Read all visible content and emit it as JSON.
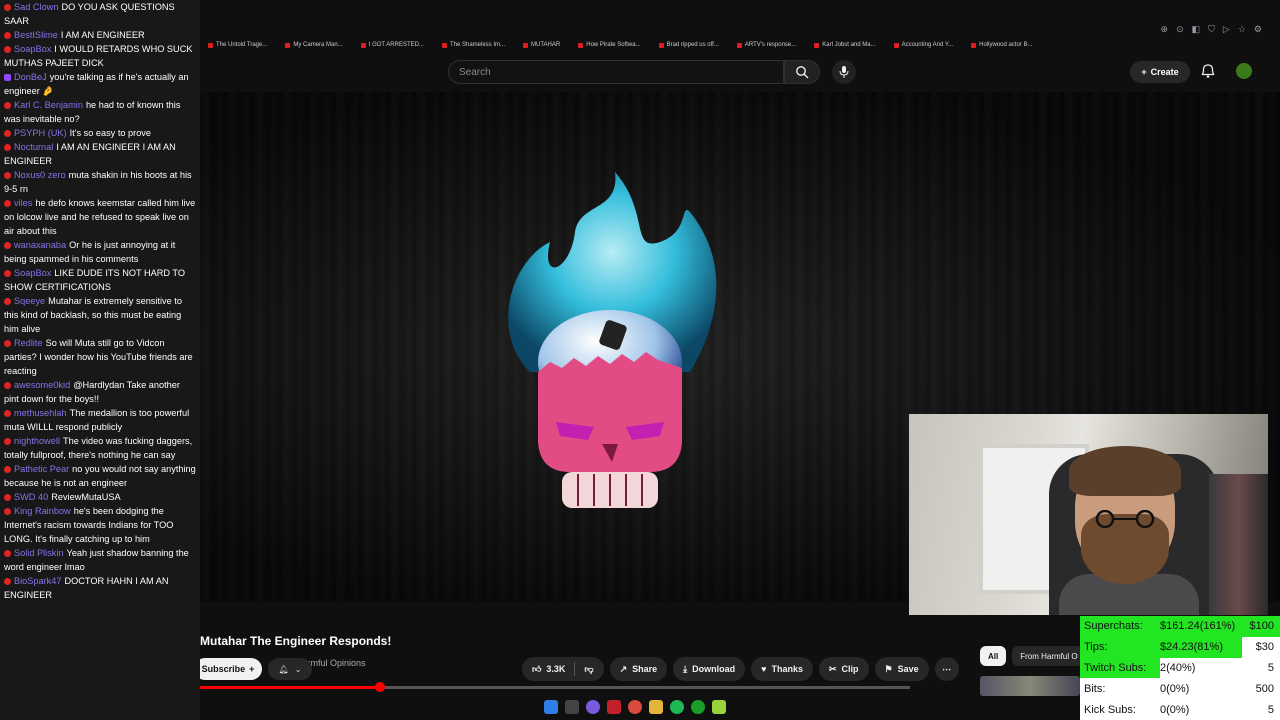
{
  "chat": {
    "messages": [
      {
        "user": "Sad Clown",
        "text": "DO YOU ASK QUESTIONS SAAR"
      },
      {
        "user": "BestISlime",
        "text": "I AM AN ENGINEER"
      },
      {
        "user": "SoapBox",
        "text": "I WOULD RETARDS WHO SUCK MUTHAS PAJEET DICK"
      },
      {
        "user": "DonBeJ",
        "text": "you're talking as if he's actually an engineer 🤌"
      },
      {
        "user": "Karl C. Benjamin",
        "text": "he had to of known this was inevitable no?"
      },
      {
        "user": "PSYPH (UK)",
        "text": "It's so easy to prove"
      },
      {
        "user": "Nocturnal",
        "text": "I AM AN ENGINEER I AM AN ENGINEER"
      },
      {
        "user": "Noxus0 zero",
        "text": "muta shakin in his boots at his 9-5 rn"
      },
      {
        "user": "viles",
        "text": "he defo knows keemstar called him live on lolcow live and he refused to speak live on air about this"
      },
      {
        "user": "wanaxanaba",
        "text": "Or he is just annoying at it being spammed in his comments"
      },
      {
        "user": "SoapBox",
        "text": "LIKE DUDE ITS NOT HARD TO SHOW CERTIFICATIONS"
      },
      {
        "user": "Sqeeye",
        "text": "Mutahar is extremely sensitive to this kind of backlash, so this must be eating him alive"
      },
      {
        "user": "Redlite",
        "text": "So will Muta still go to Vidcon parties? I wonder how his YouTube friends are reacting"
      },
      {
        "user": "awesome0kid",
        "text": "@Hardlydan Take another pint down for the boys!!"
      },
      {
        "user": "methusehlah",
        "text": "The medallion is too powerful muta WILLL respond publicly"
      },
      {
        "user": "nighthowell",
        "text": "The video was fucking daggers, totally fullproof, there's nothing he can say"
      },
      {
        "user": "Pathetic Pear",
        "text": "no you would not say anything because he is not an engineer"
      },
      {
        "user": "SWD 40",
        "text": "ReviewMutaUSA"
      },
      {
        "user": "King Rainbow",
        "text": "he's been dodging the Internet's racism towards Indians for TOO LONG. It's finally catching up to him"
      },
      {
        "user": "Solid Pliskin",
        "text": "Yeah just shadow banning the word engineer lmao"
      },
      {
        "user": "BioSpark47",
        "text": "DOCTOR HAHN I AM AN ENGINEER"
      }
    ]
  },
  "browser": {
    "bookmarks": [
      "The Untold Trage...",
      "My Camera Man...",
      "I GOT ARRESTED...",
      "The Shameless Im...",
      "MUTAHAR",
      "How Pirate Softwa...",
      "Brad ripped us off...",
      "ARTV's response...",
      "Karl Jobst and Ma...",
      "Accounting And Y...",
      "Hollywood actor B..."
    ]
  },
  "youtube": {
    "search_placeholder": "Search",
    "create_label": "Create",
    "video_title": "Mutahar The Engineer Responds!",
    "channel_name": "Harmful Opinions",
    "subscribe_label": "Subscribe",
    "likes": "3.3K",
    "share_label": "Share",
    "download_label": "Download",
    "thanks_label": "Thanks",
    "clip_label": "Clip",
    "save_label": "Save",
    "chips": [
      "All",
      "From Harmful O"
    ],
    "progress": 0.253
  },
  "stats": {
    "rows": [
      {
        "label": "Superchats:",
        "value": "$161.24(161%)",
        "goal": "$100",
        "fill": 1.0
      },
      {
        "label": "Tips:",
        "value": "$24.23(81%)",
        "goal": "$30",
        "fill": 0.81
      },
      {
        "label": "Twitch Subs:",
        "value": "2(40%)",
        "goal": "5",
        "fill": 0.4
      },
      {
        "label": "Bits:",
        "value": "0(0%)",
        "goal": "500",
        "fill": 0
      },
      {
        "label": "Kick Subs:",
        "value": "0(0%)",
        "goal": "5",
        "fill": 0
      }
    ]
  },
  "colors": {
    "accent_red": "#ff0000",
    "username": "#8a72e8",
    "stats_fill": "#22e622"
  }
}
